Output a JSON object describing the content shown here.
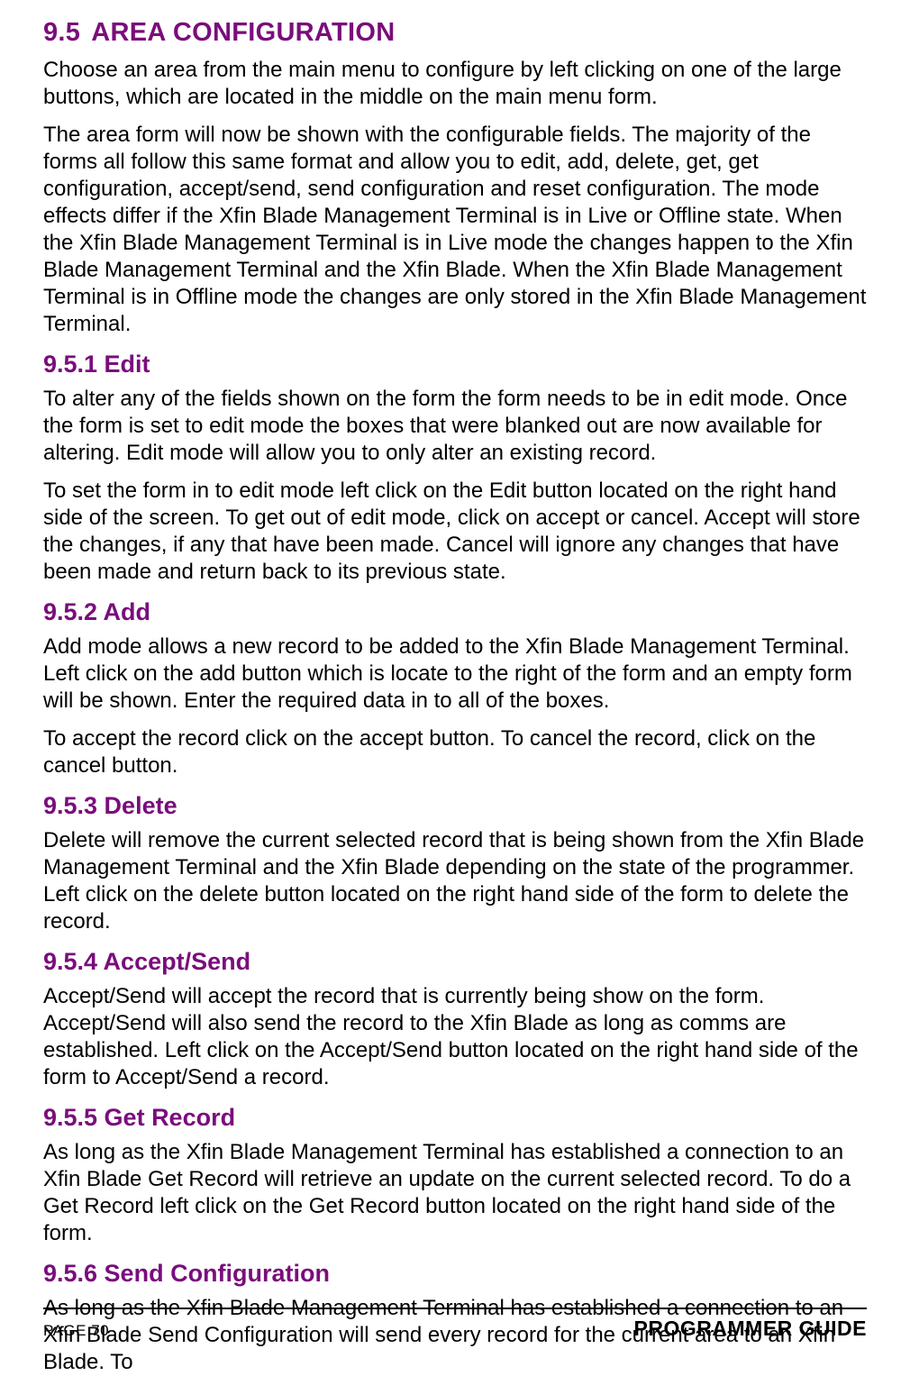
{
  "section": {
    "number": "9.5",
    "title": "AREA CONFIGURATION",
    "intro1": "Choose an area from the main menu to configure by left clicking on one of the large buttons, which are located in the middle on the main menu form.",
    "intro2": "The area form will now be shown with the configurable fields. The majority of the forms all follow this same format and allow you to edit, add, delete, get, get configuration, accept/send, send configuration and reset configuration. The mode effects differ if the Xfin Blade Management Terminal is in Live or Offline state. When the Xfin Blade Management Terminal is in Live mode the changes happen to the Xfin Blade Management Terminal and the Xfin Blade. When the Xfin Blade Management Terminal is in Offline mode the changes are only stored in the Xfin Blade Management Terminal."
  },
  "subs": {
    "s1": {
      "heading": "9.5.1 Edit",
      "p1": "To alter any of the fields shown on the form the form needs to be in edit mode. Once the form is set to edit mode the boxes that were blanked out are now available for altering. Edit mode will allow you to only alter an existing record.",
      "p2": "To set the form in to edit mode left click on the Edit button located on the right hand side of the screen. To get out of edit mode, click on accept or cancel. Accept will store the changes, if any that have been made. Cancel will ignore any changes that have been made and return back to its previous state."
    },
    "s2": {
      "heading": "9.5.2 Add",
      "p1": "Add mode allows a new record to be added to the Xfin Blade Management Terminal. Left click on the add button which is locate to the right of the form and an empty form will be shown. Enter the required data in to all of the boxes.",
      "p2": "To accept the record click on the accept button. To cancel the record, click on the cancel button."
    },
    "s3": {
      "heading": "9.5.3 Delete",
      "p1": "Delete will remove the current selected record that is being shown from the Xfin Blade Management Terminal and the Xfin Blade depending on the state of the programmer. Left click on the delete button located on the right hand side of the form to delete the record."
    },
    "s4": {
      "heading": "9.5.4 Accept/Send",
      "p1": "Accept/Send will accept the record that is currently being show on the form. Accept/Send will also send the record to the Xfin Blade as long as comms are established. Left click on the Accept/Send button located on the right hand side of the form to Accept/Send a record."
    },
    "s5": {
      "heading": "9.5.5 Get Record",
      "p1": "As long as the Xfin Blade Management Terminal has established a connection to an Xfin Blade Get Record will retrieve an update on the current selected record. To do a Get Record left click on the Get Record button located on the right hand side of the form."
    },
    "s6": {
      "heading": "9.5.6 Send Configuration",
      "p1": "As long as the Xfin Blade Management Terminal has established a connection to an Xfin Blade Send Configuration will send every record for the current area to an Xfin Blade. To"
    }
  },
  "footer": {
    "page": "PAGE 70",
    "guide": "PROGRAMMER GUIDE"
  }
}
